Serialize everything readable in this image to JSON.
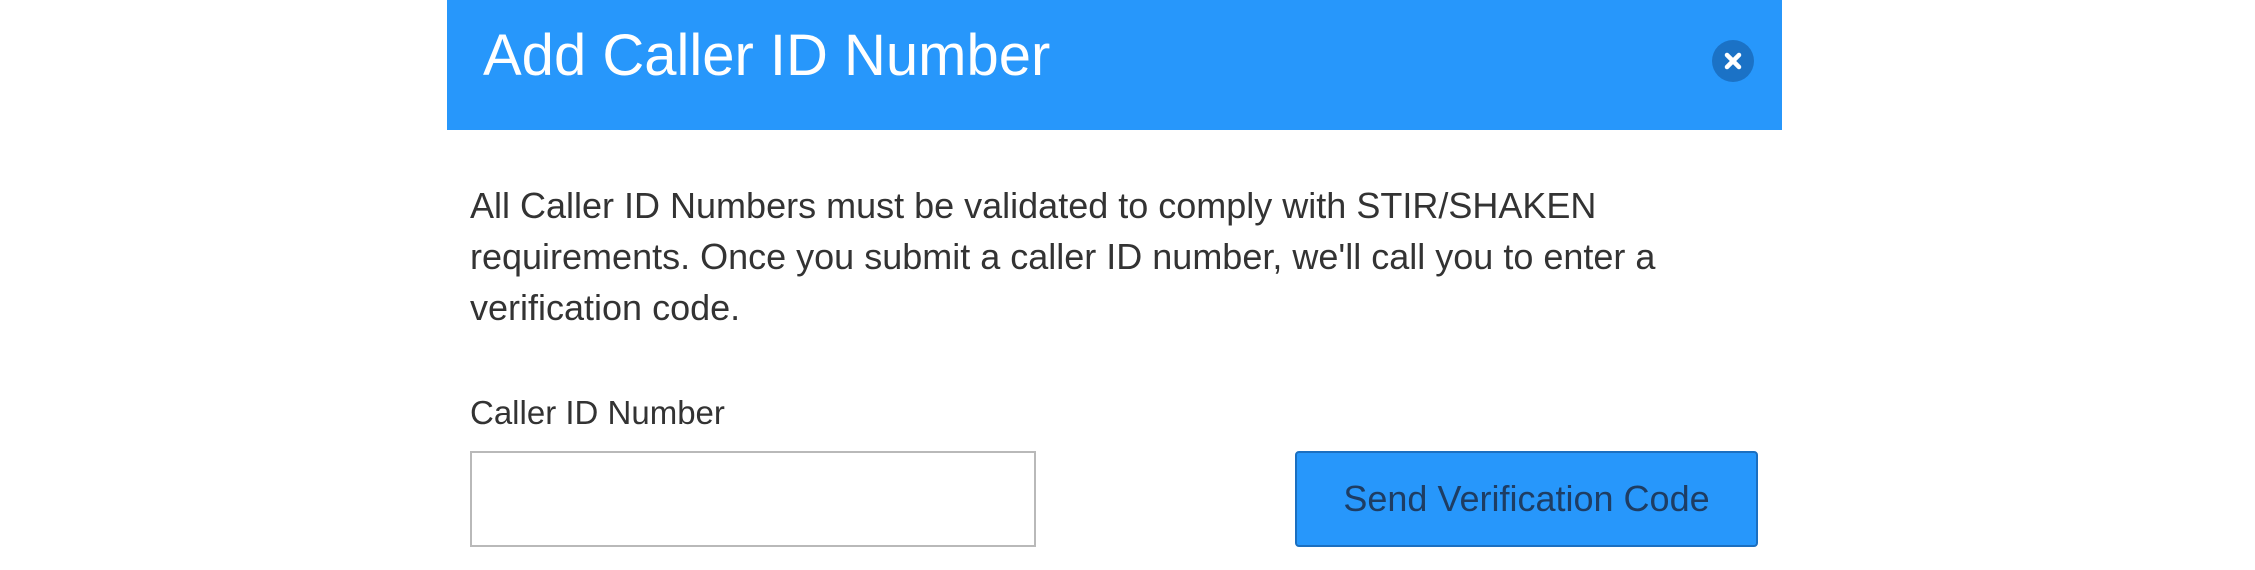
{
  "modal": {
    "title": "Add Caller ID Number",
    "description": "All Caller ID Numbers must be validated to comply with STIR/SHAKEN requirements. Once you submit a caller ID number, we'll call you to enter a verification code.",
    "close_icon": "close-circle-icon",
    "field": {
      "label": "Caller ID Number",
      "value": "",
      "placeholder": ""
    },
    "send_button_label": "Send Verification Code"
  },
  "colors": {
    "header_bg": "#2797fb",
    "close_icon_bg": "#1b72c6",
    "button_bg": "#2797fb",
    "button_text": "#1e3d63",
    "text": "#333333"
  }
}
